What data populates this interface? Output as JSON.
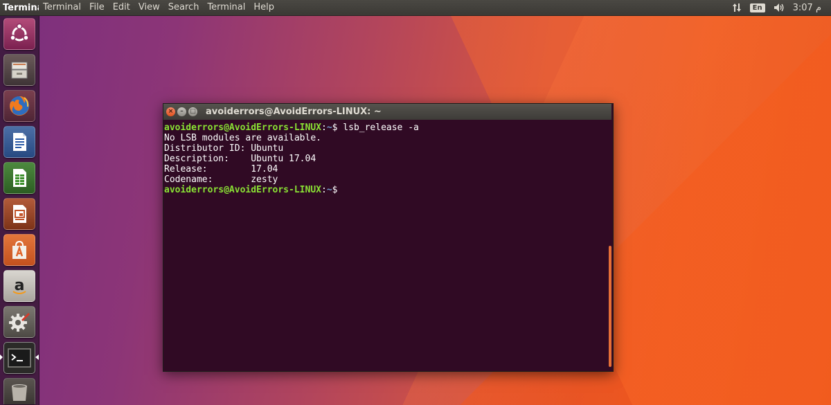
{
  "top_panel": {
    "app_name": "Terminal",
    "menu": [
      "Terminal",
      "File",
      "Edit",
      "View",
      "Search",
      "Terminal",
      "Help"
    ],
    "tray": {
      "network_icon": "updown-arrows-icon",
      "keyboard_layout": "En",
      "volume_icon": "speaker-icon",
      "clock": "3:07 م"
    }
  },
  "launcher": {
    "items": [
      {
        "name": "ubuntu-dash",
        "icon": "ubuntu-logo-icon"
      },
      {
        "name": "files",
        "icon": "file-cabinet-icon"
      },
      {
        "name": "firefox",
        "icon": "firefox-icon"
      },
      {
        "name": "libreoffice-writer",
        "icon": "writer-document-icon"
      },
      {
        "name": "libreoffice-calc",
        "icon": "calc-spreadsheet-icon"
      },
      {
        "name": "libreoffice-impress",
        "icon": "impress-presentation-icon"
      },
      {
        "name": "ubuntu-software",
        "icon": "software-bag-icon"
      },
      {
        "name": "amazon",
        "icon": "amazon-icon"
      },
      {
        "name": "system-settings",
        "icon": "settings-gear-icon"
      },
      {
        "name": "terminal",
        "icon": "terminal-prompt-icon"
      },
      {
        "name": "trash",
        "icon": "trash-icon"
      }
    ]
  },
  "terminal": {
    "title": "avoiderrors@AvoidErrors-LINUX: ~",
    "lines": [
      {
        "type": "prompt",
        "user": "avoiderrors@AvoidErrors-LINUX",
        "path": "~",
        "command": " lsb_release -a"
      },
      {
        "type": "output",
        "text": "No LSB modules are available."
      },
      {
        "type": "output",
        "text": "Distributor ID:\tUbuntu"
      },
      {
        "type": "output",
        "text": "Description:\tUbuntu 17.04"
      },
      {
        "type": "output",
        "text": "Release:\t17.04"
      },
      {
        "type": "output",
        "text": "Codename:\tzesty"
      },
      {
        "type": "prompt",
        "user": "avoiderrors@AvoidErrors-LINUX",
        "path": "~",
        "command": ""
      }
    ]
  },
  "colors": {
    "terminal_bg": "#300a24",
    "prompt_user": "#8ae234",
    "prompt_path": "#729fcf",
    "accent": "#e56f38"
  }
}
